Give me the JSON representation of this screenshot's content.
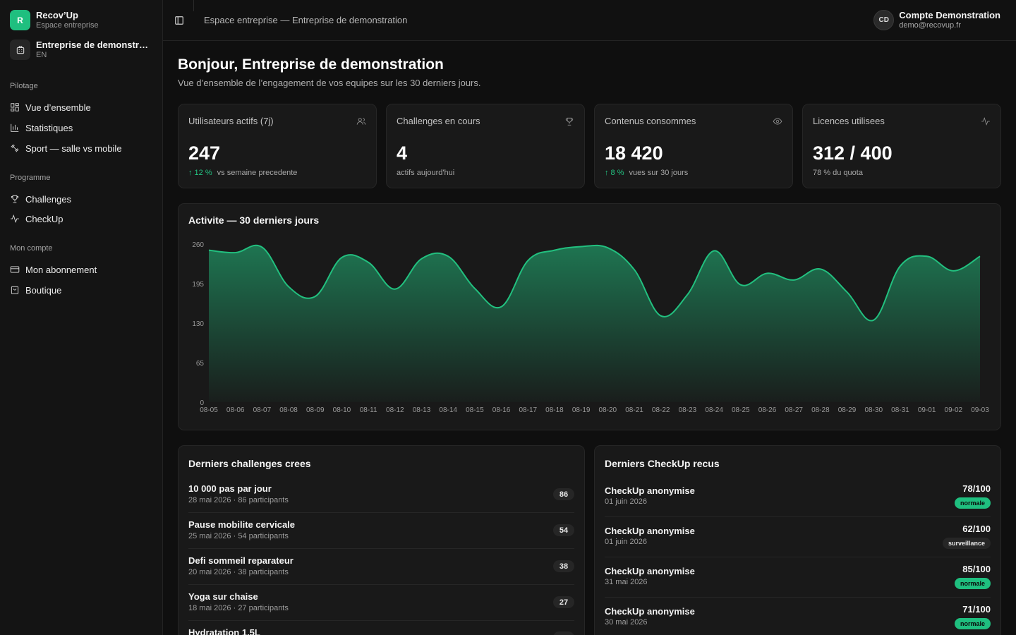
{
  "brand": {
    "name": "Recov’Up",
    "subtitle": "Espace entreprise",
    "logo_letter": "R"
  },
  "organization": {
    "name": "Entreprise de demonstration",
    "lang": "EN"
  },
  "sidebar": {
    "sections": [
      {
        "title": "Pilotage",
        "items": [
          {
            "label": "Vue d’ensemble",
            "icon": "grid-icon"
          },
          {
            "label": "Statistiques",
            "icon": "bar-chart-icon"
          },
          {
            "label": "Sport — salle vs mobile",
            "icon": "dumbbell-icon"
          }
        ]
      },
      {
        "title": "Programme",
        "items": [
          {
            "label": "Challenges",
            "icon": "trophy-icon"
          },
          {
            "label": "CheckUp",
            "icon": "pulse-icon"
          }
        ]
      },
      {
        "title": "Mon compte",
        "items": [
          {
            "label": "Mon abonnement",
            "icon": "credit-card-icon"
          },
          {
            "label": "Boutique",
            "icon": "shop-bag-icon"
          }
        ]
      }
    ]
  },
  "topbar": {
    "breadcrumb": "Espace entreprise — Entreprise de demonstration",
    "user": {
      "initials": "CD",
      "name": "Compte Demonstration",
      "email": "demo@recovup.fr"
    }
  },
  "main": {
    "greeting": "Bonjour, Entreprise de demonstration",
    "subtitle": "Vue d’ensemble de l’engagement de vos equipes sur les 30 derniers jours."
  },
  "kpis": [
    {
      "title": "Utilisateurs actifs (7j)",
      "value": "247",
      "delta": "↑ 12 %",
      "foot": "vs semaine precedente",
      "icon": "users-icon"
    },
    {
      "title": "Challenges en cours",
      "value": "4",
      "delta": "",
      "foot": "actifs aujourd'hui",
      "icon": "trophy-icon"
    },
    {
      "title": "Contenus consommes",
      "value": "18 420",
      "delta": "↑ 8 %",
      "foot": "vues sur 30 jours",
      "icon": "eye-icon"
    },
    {
      "title": "Licences utilisees",
      "value": "312 / 400",
      "delta": "",
      "foot": "78 % du quota",
      "icon": "activity-icon"
    }
  ],
  "chart_data": {
    "type": "area",
    "title": "Activite — 30 derniers jours",
    "x": [
      "08-05",
      "08-06",
      "08-07",
      "08-08",
      "08-09",
      "08-10",
      "08-11",
      "08-12",
      "08-13",
      "08-14",
      "08-15",
      "08-16",
      "08-17",
      "08-18",
      "08-19",
      "08-20",
      "08-21",
      "08-22",
      "08-23",
      "08-24",
      "08-25",
      "08-26",
      "08-27",
      "08-28",
      "08-29",
      "08-30",
      "08-31",
      "09-01",
      "09-02",
      "09-03"
    ],
    "values": [
      250,
      246,
      255,
      190,
      174,
      238,
      230,
      186,
      236,
      240,
      187,
      157,
      233,
      250,
      256,
      254,
      218,
      142,
      177,
      249,
      193,
      212,
      201,
      219,
      181,
      135,
      224,
      240,
      216,
      240
    ],
    "ylim": [
      0,
      260
    ],
    "yticks": [
      0,
      65,
      130,
      195,
      260
    ],
    "grid": false,
    "color": "#22c07f"
  },
  "challenges": {
    "title": "Derniers challenges crees",
    "items": [
      {
        "name": "10 000 pas par jour",
        "meta": "28 mai 2026 · 86 participants",
        "count": "86"
      },
      {
        "name": "Pause mobilite cervicale",
        "meta": "25 mai 2026 · 54 participants",
        "count": "54"
      },
      {
        "name": "Defi sommeil reparateur",
        "meta": "20 mai 2026 · 38 participants",
        "count": "38"
      },
      {
        "name": "Yoga sur chaise",
        "meta": "18 mai 2026 · 27 participants",
        "count": "27"
      },
      {
        "name": "Hydratation 1.5L",
        "meta": "",
        "count": ""
      }
    ]
  },
  "checkups": {
    "title": "Derniers CheckUp recus",
    "items": [
      {
        "name": "CheckUp anonymise",
        "date": "01 juin 2026",
        "score": "78/100",
        "status": "normale",
        "ok": true
      },
      {
        "name": "CheckUp anonymise",
        "date": "01 juin 2026",
        "score": "62/100",
        "status": "surveillance",
        "ok": false
      },
      {
        "name": "CheckUp anonymise",
        "date": "31 mai 2026",
        "score": "85/100",
        "status": "normale",
        "ok": true
      },
      {
        "name": "CheckUp anonymise",
        "date": "30 mai 2026",
        "score": "71/100",
        "status": "normale",
        "ok": true
      }
    ]
  }
}
